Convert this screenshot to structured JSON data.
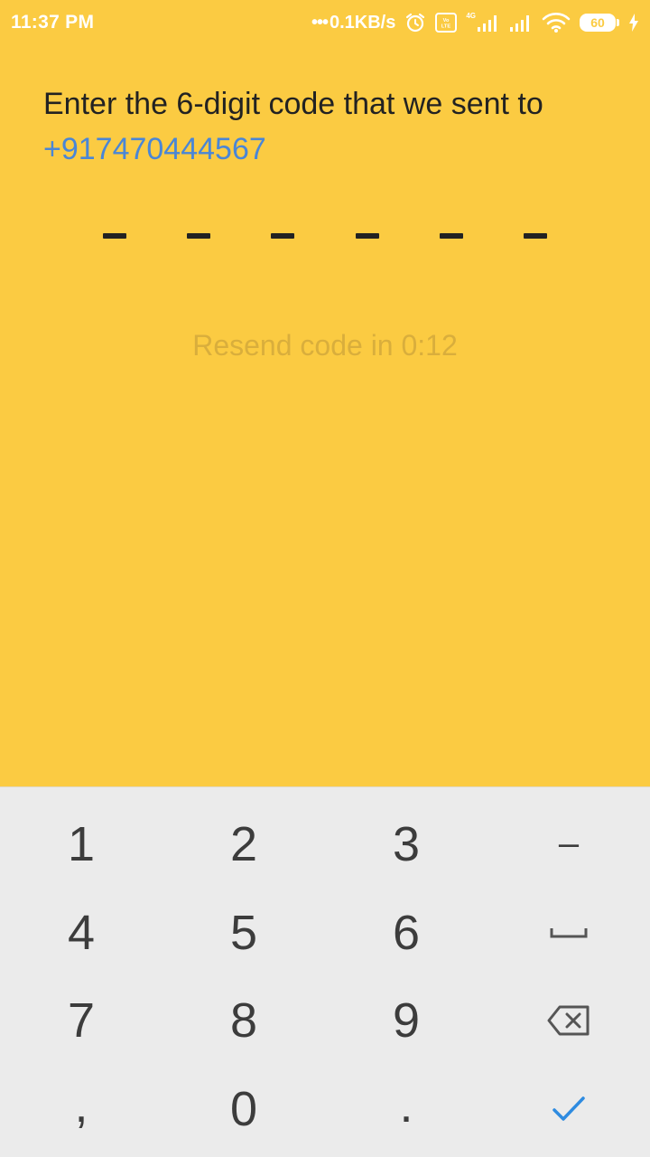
{
  "status_bar": {
    "time": "11:37 PM",
    "net_dots": "•••",
    "net_speed": "0.1KB/s",
    "volte_label": "Vo\nLTE",
    "network_tag": "4G",
    "battery_level": "60",
    "icons": [
      "alarm-icon",
      "volte-icon",
      "signal-icon",
      "signal-icon",
      "wifi-icon",
      "battery-icon",
      "charging-icon"
    ]
  },
  "prompt": {
    "text": "Enter the 6-digit code that we sent to",
    "phone": "+917470444567"
  },
  "code": {
    "length": 6,
    "entered": ""
  },
  "resend": {
    "text": "Resend code in 0:12"
  },
  "keyboard": {
    "keys": [
      {
        "label": "1"
      },
      {
        "label": "2"
      },
      {
        "label": "3"
      },
      {
        "label": "–"
      },
      {
        "label": "4"
      },
      {
        "label": "5"
      },
      {
        "label": "6"
      },
      {
        "label": "␣",
        "icon": "space-icon"
      },
      {
        "label": "7"
      },
      {
        "label": "8"
      },
      {
        "label": "9"
      },
      {
        "label": "⌫",
        "icon": "backspace-icon"
      },
      {
        "label": ","
      },
      {
        "label": "0"
      },
      {
        "label": "."
      },
      {
        "label": "✓",
        "icon": "checkmark-icon"
      }
    ],
    "accent_color": "#2E8BE0"
  },
  "colors": {
    "background": "#FBCB42",
    "keyboard_bg": "#EBEBEB",
    "phone_link": "#4A86D6",
    "resend_disabled": "#D9AE3C"
  }
}
